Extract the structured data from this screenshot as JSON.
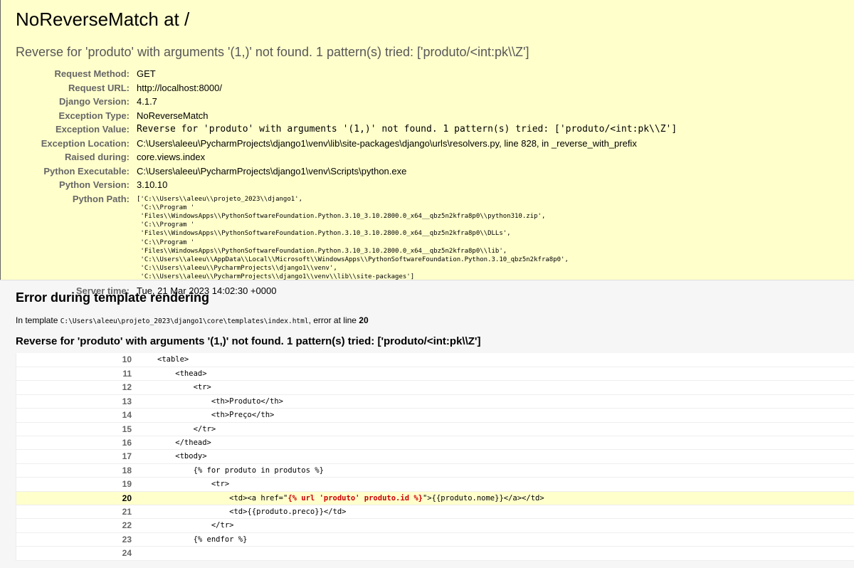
{
  "summary": {
    "title": "NoReverseMatch at /",
    "exception_message": "Reverse for 'produto' with arguments '(1,)' not found. 1 pattern(s) tried: ['produto/<int:pk\\\\Z']",
    "meta": [
      {
        "label": "Request Method:",
        "value": "GET"
      },
      {
        "label": "Request URL:",
        "value": "http://localhost:8000/"
      },
      {
        "label": "Django Version:",
        "value": "4.1.7"
      },
      {
        "label": "Exception Type:",
        "value": "NoReverseMatch"
      },
      {
        "label": "Exception Value:",
        "value": "Reverse for 'produto' with arguments '(1,)' not found. 1 pattern(s) tried: ['produto/<int:pk\\\\Z']"
      },
      {
        "label": "Exception Location:",
        "value": "C:\\Users\\aleeu\\PycharmProjects\\django1\\venv\\lib\\site-packages\\django\\urls\\resolvers.py, line 828, in _reverse_with_prefix"
      },
      {
        "label": "Raised during:",
        "value": "core.views.index"
      },
      {
        "label": "Python Executable:",
        "value": "C:\\Users\\aleeu\\PycharmProjects\\django1\\venv\\Scripts\\python.exe"
      },
      {
        "label": "Python Version:",
        "value": "3.10.10"
      },
      {
        "label": "Python Path:",
        "value": "['C:\\\\Users\\\\aleeu\\\\projeto_2023\\\\django1',\n 'C:\\\\Program '\n 'Files\\\\WindowsApps\\\\PythonSoftwareFoundation.Python.3.10_3.10.2800.0_x64__qbz5n2kfra8p0\\\\python310.zip',\n 'C:\\\\Program '\n 'Files\\\\WindowsApps\\\\PythonSoftwareFoundation.Python.3.10_3.10.2800.0_x64__qbz5n2kfra8p0\\\\DLLs',\n 'C:\\\\Program '\n 'Files\\\\WindowsApps\\\\PythonSoftwareFoundation.Python.3.10_3.10.2800.0_x64__qbz5n2kfra8p0\\\\lib',\n 'C:\\\\Users\\\\aleeu\\\\AppData\\\\Local\\\\Microsoft\\\\WindowsApps\\\\PythonSoftwareFoundation.Python.3.10_qbz5n2kfra8p0',\n 'C:\\\\Users\\\\aleeu\\\\PycharmProjects\\\\django1\\\\venv',\n 'C:\\\\Users\\\\aleeu\\\\PycharmProjects\\\\django1\\\\venv\\\\lib\\\\site-packages']"
      },
      {
        "label": "Server time:",
        "value": "Tue, 21 Mar 2023 14:02:30 +0000"
      }
    ]
  },
  "template_error": {
    "heading": "Error during template rendering",
    "in_template_label": "In template ",
    "template_path": "C:\\Users\\aleeu\\projeto_2023\\django1\\core\\templates\\index.html",
    "error_at_line_label": ", error at line ",
    "error_line": "20",
    "message": "Reverse for 'produto' with arguments '(1,)' not found. 1 pattern(s) tried: ['produto/<int:pk\\\\Z']",
    "source_lines": [
      {
        "num": "10",
        "code": "<table>"
      },
      {
        "num": "11",
        "code": "    <thead>"
      },
      {
        "num": "12",
        "code": "        <tr>"
      },
      {
        "num": "13",
        "code": "            <th>Produto</th>"
      },
      {
        "num": "14",
        "code": "            <th>Preço</th>"
      },
      {
        "num": "15",
        "code": "        </tr>"
      },
      {
        "num": "16",
        "code": "    </thead>"
      },
      {
        "num": "17",
        "code": "    <tbody>"
      },
      {
        "num": "18",
        "code": "        {% for produto in produtos %}"
      },
      {
        "num": "19",
        "code": "            <tr>"
      },
      {
        "num": "20",
        "before": "                <td><a href=\"",
        "highlight": "{% url 'produto' produto.id %}",
        "after": "\">{{produto.nome}}</a></td>"
      },
      {
        "num": "21",
        "code": "                <td>{{produto.preco}}</td>"
      },
      {
        "num": "22",
        "code": "            </tr>"
      },
      {
        "num": "23",
        "code": "        {% endfor %}"
      },
      {
        "num": "24",
        "code": ""
      }
    ]
  }
}
